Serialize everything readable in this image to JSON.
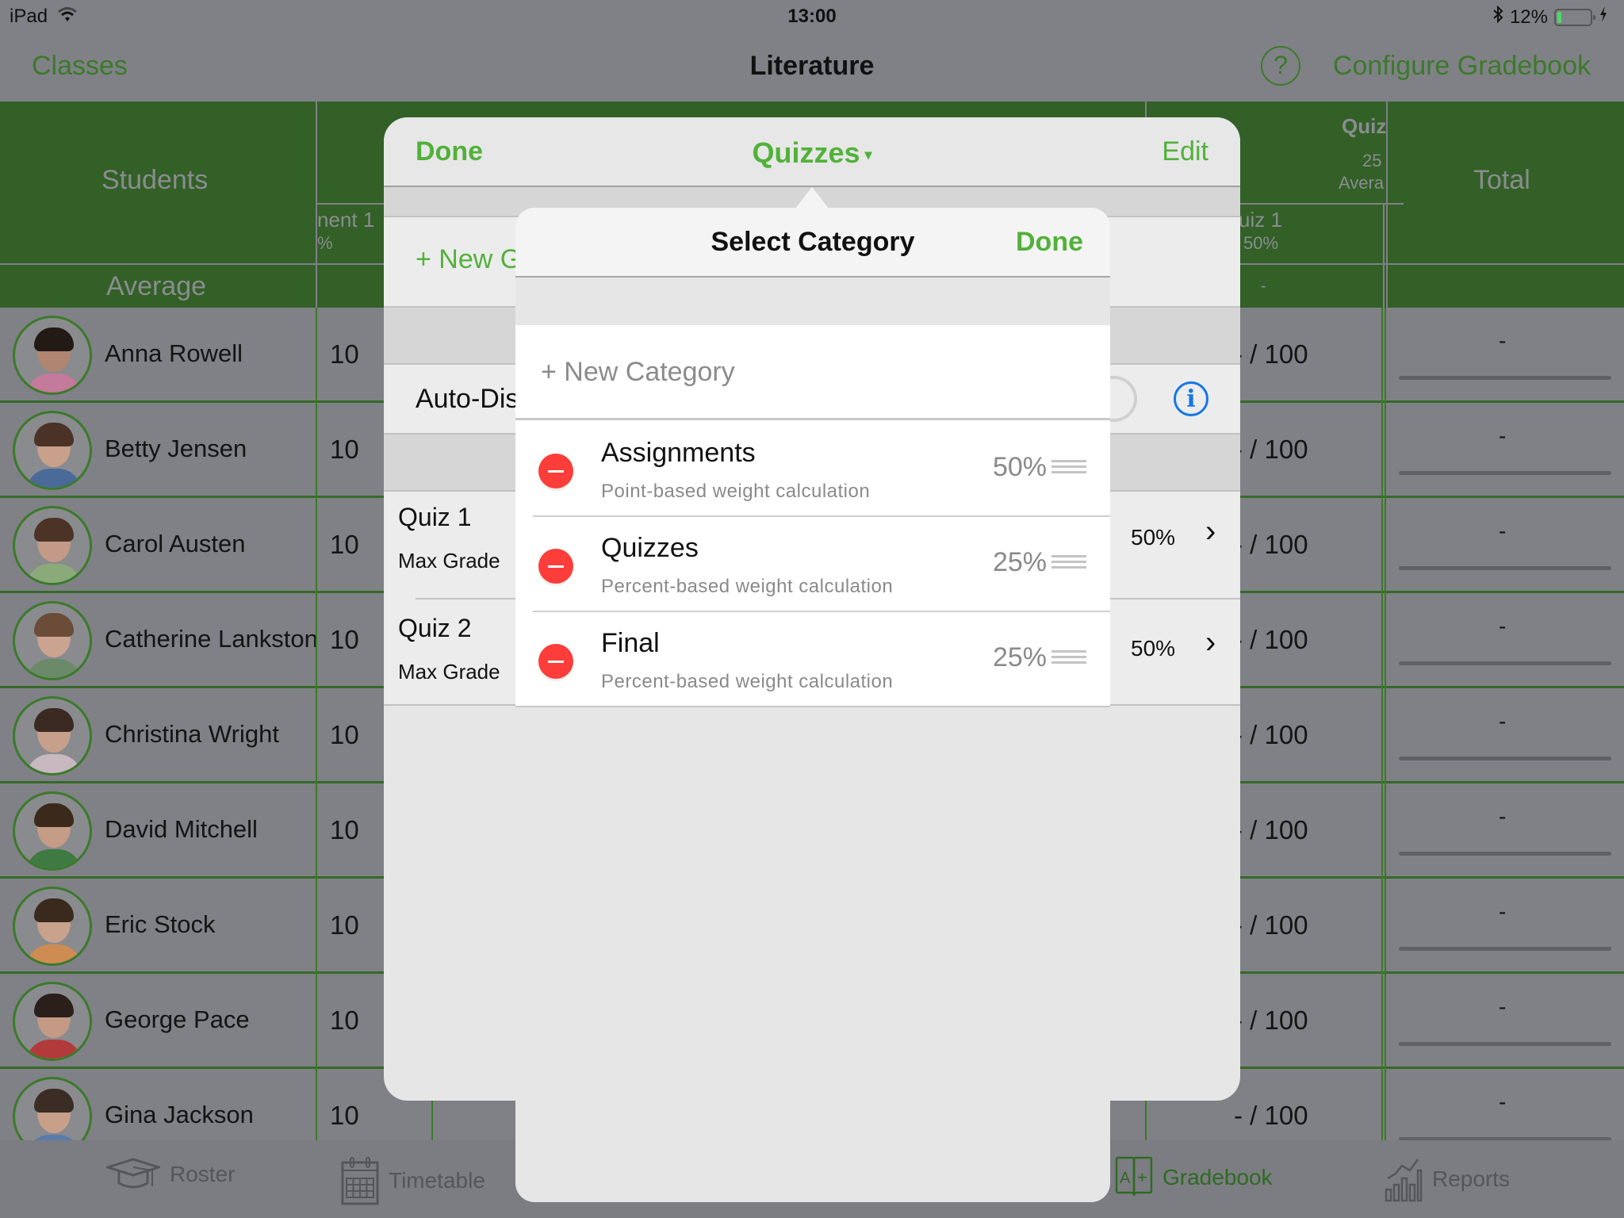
{
  "status_bar": {
    "device": "iPad",
    "time": "13:00",
    "battery_percent_text": "12%",
    "battery_level": 0.12,
    "wifi_icon": "wifi-icon",
    "bluetooth_icon": "bluetooth-icon",
    "charging_icon": "charging-bolt-icon"
  },
  "nav": {
    "back_label": "Classes",
    "title": "Literature",
    "help_label": "?",
    "configure_label": "Configure Gradebook"
  },
  "colors": {
    "accent_green": "#52b13a",
    "header_green": "#326026",
    "delete_red": "#fc3d39",
    "info_blue": "#1477e6"
  },
  "table": {
    "students_header": "Students",
    "average_label": "Average",
    "assignment_col_header_partial": "nent 1",
    "assignment_col_sub_partial": "%",
    "quiz_group_header_partial": "Quiz",
    "quiz_group_weight_partial": "25",
    "quiz_group_average_partial": "Avera",
    "quiz1_header_partial": "uiz 1",
    "quiz1_weight": "50%",
    "quiz1_average": "-",
    "total_header": "Total",
    "rows": [
      {
        "name": "Anna Rowell",
        "grade": "10",
        "quiz": "- / 100",
        "total": "-"
      },
      {
        "name": "Betty Jensen",
        "grade": "10",
        "quiz": "- / 100",
        "total": "-"
      },
      {
        "name": "Carol Austen",
        "grade": "10",
        "quiz": "- / 100",
        "total": "-"
      },
      {
        "name": "Catherine Lankston",
        "grade": "10",
        "quiz": "- / 100",
        "total": "-"
      },
      {
        "name": "Christina Wright",
        "grade": "10",
        "quiz": "- / 100",
        "total": "-"
      },
      {
        "name": "David Mitchell",
        "grade": "10",
        "quiz": "- / 100",
        "total": "-"
      },
      {
        "name": "Eric Stock",
        "grade": "10",
        "quiz": "- / 100",
        "total": "-"
      },
      {
        "name": "George Pace",
        "grade": "10",
        "quiz": "- / 100",
        "total": "-"
      },
      {
        "name": "Gina Jackson",
        "grade": "10",
        "quiz": "- / 100",
        "total": "-"
      }
    ]
  },
  "tabbar": {
    "tabs": [
      {
        "label": "Roster",
        "icon": "graduation-cap-icon",
        "active": false
      },
      {
        "label": "Timetable",
        "icon": "calendar-icon",
        "active": false
      },
      {
        "label": "Gradebook",
        "icon": "gradebook-book-icon",
        "active": true
      },
      {
        "label": "Reports",
        "icon": "chart-icon",
        "active": false
      }
    ]
  },
  "config_popover": {
    "done_label": "Done",
    "title": "Quizzes",
    "title_caret": "▾",
    "edit_label": "Edit",
    "new_grade_partial": "+ New G",
    "auto_label_partial": "Auto-Dis",
    "info_label": "i",
    "items": [
      {
        "name": "Quiz 1",
        "sub": "Max Grade",
        "weight": "50%",
        "chevron": "›"
      },
      {
        "name": "Quiz 2",
        "sub": "Max Grade",
        "weight": "50%",
        "chevron": "›"
      }
    ]
  },
  "select_category": {
    "title": "Select Category",
    "done_label": "Done",
    "new_category_label": "+ New Category",
    "categories": [
      {
        "name": "Assignments",
        "description": "Point-based weight calculation",
        "weight": "50%"
      },
      {
        "name": "Quizzes",
        "description": "Percent-based weight calculation",
        "weight": "25%"
      },
      {
        "name": "Final",
        "description": "Percent-based weight calculation",
        "weight": "25%"
      }
    ]
  }
}
